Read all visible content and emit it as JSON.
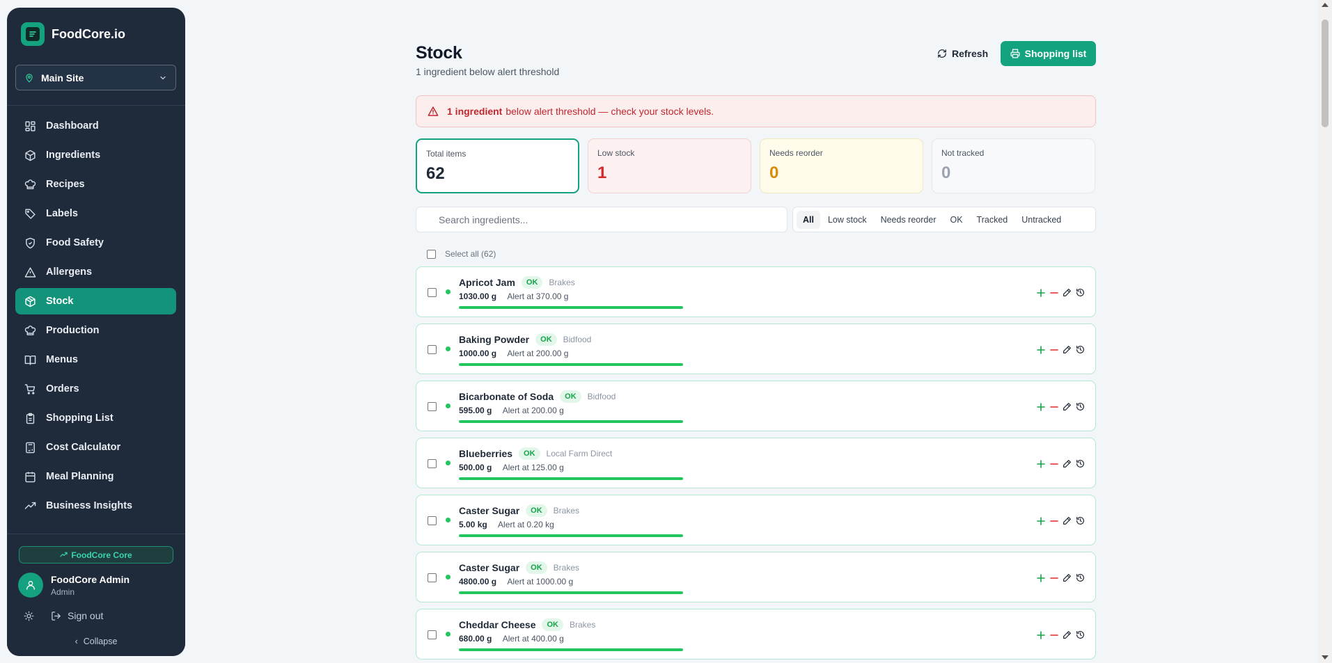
{
  "brand": {
    "name": "FoodCore.io",
    "icon": "document-icon"
  },
  "site": {
    "label": "Main Site",
    "icon": "map-pin-icon"
  },
  "nav": [
    {
      "label": "Dashboard",
      "icon": "grid-icon",
      "active": false
    },
    {
      "label": "Ingredients",
      "icon": "package-icon",
      "active": false
    },
    {
      "label": "Recipes",
      "icon": "chef-hat-icon",
      "active": false
    },
    {
      "label": "Labels",
      "icon": "tag-icon",
      "active": false
    },
    {
      "label": "Food Safety",
      "icon": "shield-icon",
      "active": false
    },
    {
      "label": "Allergens",
      "icon": "warning-icon",
      "active": false
    },
    {
      "label": "Stock",
      "icon": "box-icon",
      "active": true
    },
    {
      "label": "Production",
      "icon": "chef-hat-icon",
      "active": false
    },
    {
      "label": "Menus",
      "icon": "book-icon",
      "active": false
    },
    {
      "label": "Orders",
      "icon": "cart-icon",
      "active": false
    },
    {
      "label": "Shopping List",
      "icon": "clipboard-icon",
      "active": false
    },
    {
      "label": "Cost Calculator",
      "icon": "calculator-icon",
      "active": false
    },
    {
      "label": "Meal Planning",
      "icon": "calendar-icon",
      "active": false
    },
    {
      "label": "Business Insights",
      "icon": "trend-up-icon",
      "active": false
    }
  ],
  "plan": {
    "label": "FoodCore Core"
  },
  "user": {
    "name": "FoodCore Admin",
    "role": "Admin"
  },
  "footer": {
    "signout": "Sign out",
    "collapse": "Collapse"
  },
  "header": {
    "title": "Stock",
    "subtitle": "1 ingredient below alert threshold",
    "refresh": "Refresh",
    "shopping_list": "Shopping list"
  },
  "alert": {
    "strong": "1 ingredient",
    "text": "below alert threshold — check your stock levels."
  },
  "stats": {
    "total": {
      "label": "Total items",
      "value": "62"
    },
    "low": {
      "label": "Low stock",
      "value": "1"
    },
    "reorder": {
      "label": "Needs reorder",
      "value": "0"
    },
    "not_tracked": {
      "label": "Not tracked",
      "value": "0"
    }
  },
  "search": {
    "placeholder": "Search ingredients..."
  },
  "filters": [
    "All",
    "Low stock",
    "Needs reorder",
    "OK",
    "Tracked",
    "Untracked"
  ],
  "select_all": "Select all (62)",
  "colors": {
    "accent": "#14a37f",
    "sidebar": "#1f2a3a",
    "ok": "#22c55e",
    "danger": "#d32a2a",
    "warning": "#d98b0a"
  },
  "items": [
    {
      "name": "Apricot Jam",
      "status": "OK",
      "supplier": "Brakes",
      "qty": "1030.00 g",
      "alert": "Alert at 370.00 g",
      "level": 1.0
    },
    {
      "name": "Baking Powder",
      "status": "OK",
      "supplier": "Bidfood",
      "qty": "1000.00 g",
      "alert": "Alert at 200.00 g",
      "level": 1.0
    },
    {
      "name": "Bicarbonate of Soda",
      "status": "OK",
      "supplier": "Bidfood",
      "qty": "595.00 g",
      "alert": "Alert at 200.00 g",
      "level": 1.0
    },
    {
      "name": "Blueberries",
      "status": "OK",
      "supplier": "Local Farm Direct",
      "qty": "500.00 g",
      "alert": "Alert at 125.00 g",
      "level": 1.0
    },
    {
      "name": "Caster Sugar",
      "status": "OK",
      "supplier": "Brakes",
      "qty": "5.00 kg",
      "alert": "Alert at 0.20 kg",
      "level": 1.0
    },
    {
      "name": "Caster Sugar",
      "status": "OK",
      "supplier": "Brakes",
      "qty": "4800.00 g",
      "alert": "Alert at 1000.00 g",
      "level": 1.0
    },
    {
      "name": "Cheddar Cheese",
      "status": "OK",
      "supplier": "Brakes",
      "qty": "680.00 g",
      "alert": "Alert at 400.00 g",
      "level": 1.0
    }
  ]
}
